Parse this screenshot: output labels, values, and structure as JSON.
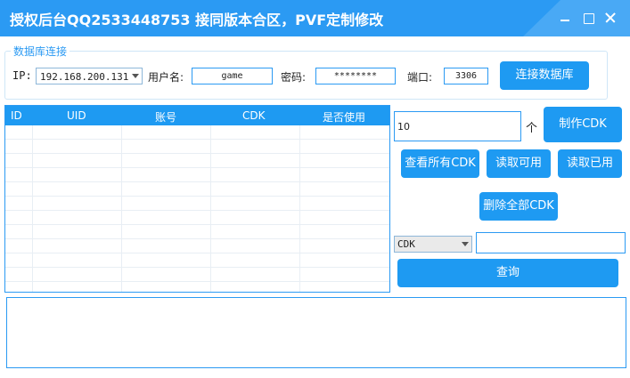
{
  "window": {
    "title": "授权后台QQ2533448753 接同版本合区，PVF定制修改",
    "accent_color": "#1e9af2"
  },
  "db_connect": {
    "group_label": "数据库连接",
    "ip_label": "IP:",
    "ip_value": "192.168.200.131",
    "username_label": "用户名:",
    "username_value": "game",
    "password_label": "密码:",
    "password_value": "********",
    "port_label": "端口:",
    "port_value": "3306",
    "connect_button": "连接数据库"
  },
  "cdk_table": {
    "columns": [
      "ID",
      "UID",
      "账号",
      "CDK",
      "是否使用"
    ],
    "rows": []
  },
  "cdk_actions": {
    "count_value": "10",
    "count_unit": "个",
    "make_button": "制作CDK",
    "view_all_button": "查看所有CDK",
    "read_available_button": "读取可用",
    "read_used_button": "读取已用",
    "delete_all_button": "删除全部CDK"
  },
  "query": {
    "field_select": "CDK",
    "input_value": "",
    "query_button": "查询"
  },
  "log": {
    "text": ""
  },
  "icons": {
    "minimize": "minimize-icon",
    "maximize": "maximize-icon",
    "close": "close-icon",
    "dropdown": "chevron-down-icon"
  }
}
